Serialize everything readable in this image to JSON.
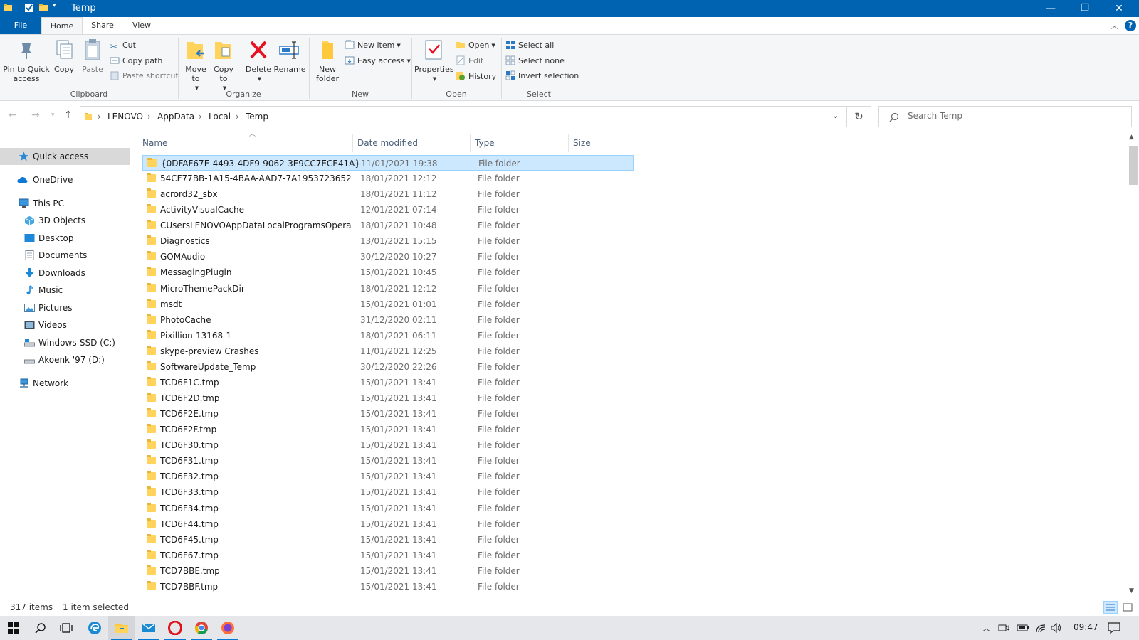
{
  "window": {
    "title": "Temp",
    "controls": {
      "minimize": "—",
      "restore": "❐",
      "close": "✕"
    }
  },
  "ribbon_tabs": [
    "File",
    "Home",
    "Share",
    "View"
  ],
  "ribbon": {
    "clipboard": {
      "label": "Clipboard",
      "pin": "Pin to Quick access",
      "copy": "Copy",
      "paste": "Paste",
      "cut": "Cut",
      "copy_path": "Copy path",
      "paste_shortcut": "Paste shortcut"
    },
    "organize": {
      "label": "Organize",
      "move_to": "Move to",
      "copy_to": "Copy to",
      "delete": "Delete",
      "rename": "Rename"
    },
    "new": {
      "label": "New",
      "new_folder": "New folder",
      "new_item": "New item",
      "easy_access": "Easy access"
    },
    "open": {
      "label": "Open",
      "properties": "Properties",
      "open": "Open",
      "edit": "Edit",
      "history": "History"
    },
    "select": {
      "label": "Select",
      "select_all": "Select all",
      "select_none": "Select none",
      "invert_selection": "Invert selection"
    }
  },
  "address": {
    "breadcrumb": [
      "LENOVO",
      "AppData",
      "Local",
      "Temp"
    ],
    "search_placeholder": "Search Temp"
  },
  "nav_pane": {
    "items": [
      {
        "label": "Quick access",
        "icon": "star-icon",
        "selected": true
      },
      {
        "label": "OneDrive",
        "icon": "cloud-icon"
      },
      {
        "label": "This PC",
        "icon": "computer-icon"
      },
      {
        "label": "3D Objects",
        "icon": "cube-icon"
      },
      {
        "label": "Desktop",
        "icon": "desktop-icon"
      },
      {
        "label": "Documents",
        "icon": "document-icon"
      },
      {
        "label": "Downloads",
        "icon": "download-icon"
      },
      {
        "label": "Music",
        "icon": "music-icon"
      },
      {
        "label": "Pictures",
        "icon": "picture-icon"
      },
      {
        "label": "Videos",
        "icon": "video-icon"
      },
      {
        "label": "Windows-SSD (C:)",
        "icon": "drive-icon"
      },
      {
        "label": "Akoenk '97 (D:)",
        "icon": "drive-icon"
      },
      {
        "label": "Network",
        "icon": "network-icon"
      }
    ]
  },
  "file_list": {
    "columns": [
      "Name",
      "Date modified",
      "Type",
      "Size"
    ],
    "rows": [
      {
        "name": "{0DFAF67E-4493-4DF9-9062-3E9CC7ECE41A}",
        "date": "11/01/2021 19:38",
        "type": "File folder",
        "selected": true
      },
      {
        "name": "54CF77BB-1A15-4BAA-AAD7-7A1953723652",
        "date": "18/01/2021 12:12",
        "type": "File folder"
      },
      {
        "name": "acrord32_sbx",
        "date": "18/01/2021 11:12",
        "type": "File folder"
      },
      {
        "name": "ActivityVisualCache",
        "date": "12/01/2021 07:14",
        "type": "File folder"
      },
      {
        "name": "CUsersLENOVOAppDataLocalProgramsOpera",
        "date": "18/01/2021 10:48",
        "type": "File folder"
      },
      {
        "name": "Diagnostics",
        "date": "13/01/2021 15:15",
        "type": "File folder"
      },
      {
        "name": "GOMAudio",
        "date": "30/12/2020 10:27",
        "type": "File folder"
      },
      {
        "name": "MessagingPlugin",
        "date": "15/01/2021 10:45",
        "type": "File folder"
      },
      {
        "name": "MicroThemePackDir",
        "date": "18/01/2021 12:12",
        "type": "File folder"
      },
      {
        "name": "msdt",
        "date": "15/01/2021 01:01",
        "type": "File folder"
      },
      {
        "name": "PhotoCache",
        "date": "31/12/2020 02:11",
        "type": "File folder"
      },
      {
        "name": "Pixillion-13168-1",
        "date": "18/01/2021 06:11",
        "type": "File folder"
      },
      {
        "name": "skype-preview Crashes",
        "date": "11/01/2021 12:25",
        "type": "File folder"
      },
      {
        "name": "SoftwareUpdate_Temp",
        "date": "30/12/2020 22:26",
        "type": "File folder"
      },
      {
        "name": "TCD6F1C.tmp",
        "date": "15/01/2021 13:41",
        "type": "File folder"
      },
      {
        "name": "TCD6F2D.tmp",
        "date": "15/01/2021 13:41",
        "type": "File folder"
      },
      {
        "name": "TCD6F2E.tmp",
        "date": "15/01/2021 13:41",
        "type": "File folder"
      },
      {
        "name": "TCD6F2F.tmp",
        "date": "15/01/2021 13:41",
        "type": "File folder"
      },
      {
        "name": "TCD6F30.tmp",
        "date": "15/01/2021 13:41",
        "type": "File folder"
      },
      {
        "name": "TCD6F31.tmp",
        "date": "15/01/2021 13:41",
        "type": "File folder"
      },
      {
        "name": "TCD6F32.tmp",
        "date": "15/01/2021 13:41",
        "type": "File folder"
      },
      {
        "name": "TCD6F33.tmp",
        "date": "15/01/2021 13:41",
        "type": "File folder"
      },
      {
        "name": "TCD6F34.tmp",
        "date": "15/01/2021 13:41",
        "type": "File folder"
      },
      {
        "name": "TCD6F44.tmp",
        "date": "15/01/2021 13:41",
        "type": "File folder"
      },
      {
        "name": "TCD6F45.tmp",
        "date": "15/01/2021 13:41",
        "type": "File folder"
      },
      {
        "name": "TCD6F67.tmp",
        "date": "15/01/2021 13:41",
        "type": "File folder"
      },
      {
        "name": "TCD7BBE.tmp",
        "date": "15/01/2021 13:41",
        "type": "File folder"
      },
      {
        "name": "TCD7BBF.tmp",
        "date": "15/01/2021 13:41",
        "type": "File folder"
      }
    ]
  },
  "status_bar": {
    "item_count": "317 items",
    "selection": "1 item selected"
  },
  "taskbar": {
    "apps": [
      "start-icon",
      "search-icon",
      "task-view-icon",
      "edge-icon",
      "file-explorer-icon",
      "mail-icon",
      "opera-icon",
      "chrome-icon",
      "firefox-icon"
    ],
    "clock": "09:47"
  },
  "colors": {
    "titlebar": "#0063b1",
    "selection_bg": "#cce8ff",
    "selection_border": "#99d1ff",
    "folder": "#ffd35c"
  }
}
